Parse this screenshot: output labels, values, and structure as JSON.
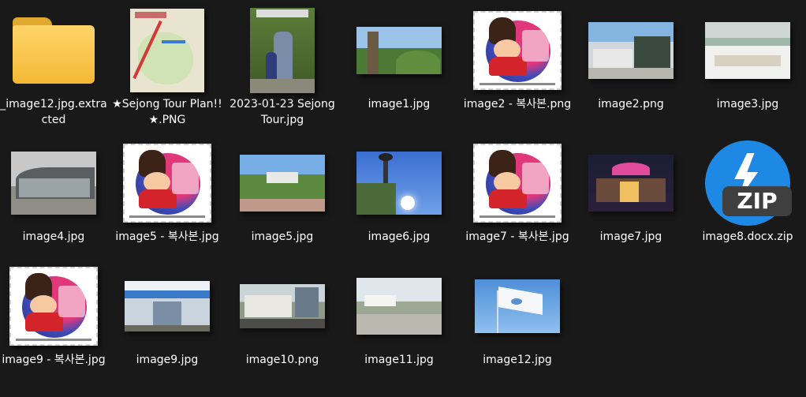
{
  "files": [
    {
      "label": "_image12.jpg.extracted",
      "icon": "folder-icon"
    },
    {
      "label": "★Sejong Tour Plan!!★.PNG"
    },
    {
      "label": "2023-01-23 Sejong Tour.jpg"
    },
    {
      "label": "image1.jpg"
    },
    {
      "label": "image2 - 복사본.png"
    },
    {
      "label": "image2.png"
    },
    {
      "label": "image3.jpg"
    },
    {
      "label": "image4.jpg"
    },
    {
      "label": "image5 - 복사본.jpg"
    },
    {
      "label": "image5.jpg"
    },
    {
      "label": "image6.jpg"
    },
    {
      "label": "image7 - 복사본.jpg"
    },
    {
      "label": "image7.jpg"
    },
    {
      "label": "image8.docx.zip",
      "icon": "zip-archive-icon",
      "badge": "ZIP"
    },
    {
      "label": "image9 - 복사본.jpg"
    },
    {
      "label": "image9.jpg"
    },
    {
      "label": "image10.png"
    },
    {
      "label": "image11.jpg"
    },
    {
      "label": "image12.jpg"
    }
  ]
}
